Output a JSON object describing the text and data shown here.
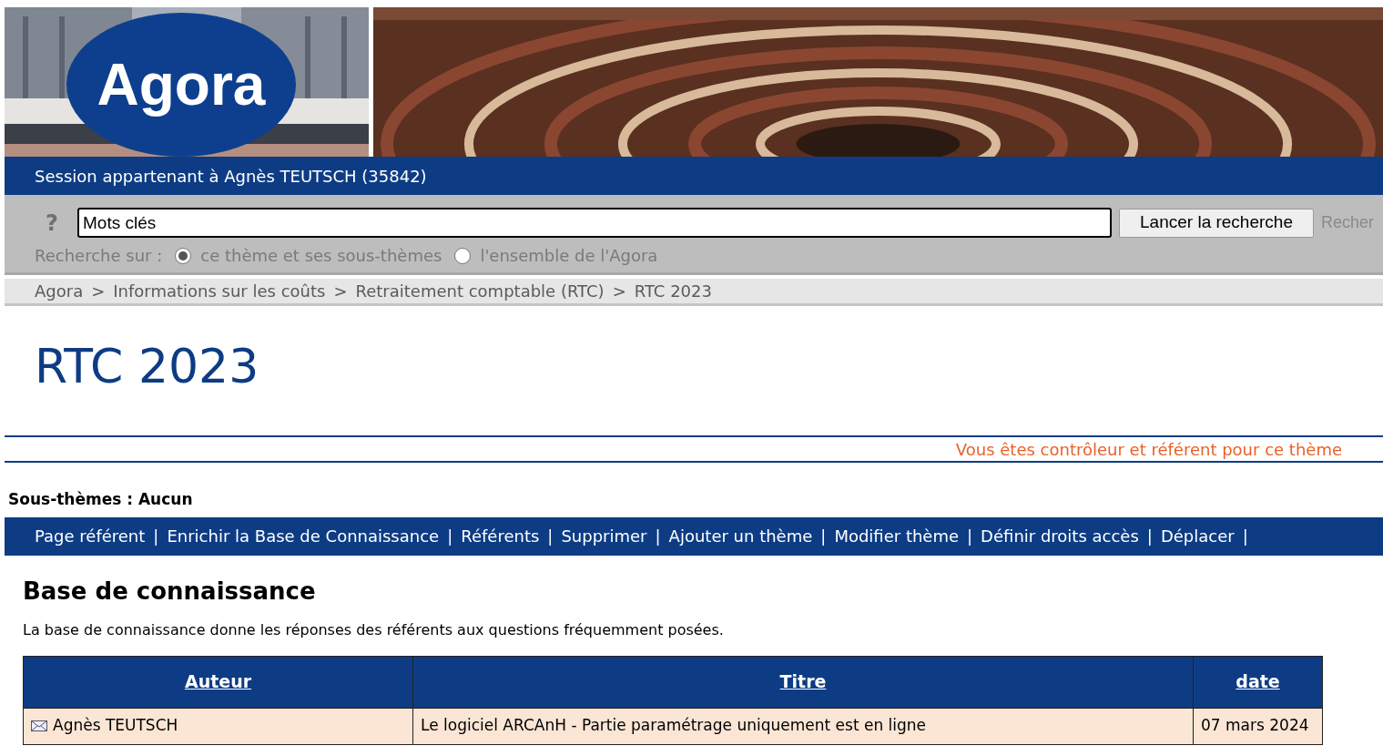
{
  "logo": {
    "text": "Agora"
  },
  "session_bar": {
    "text": "Session appartenant à Agnès TEUTSCH (35842)"
  },
  "search": {
    "help": "?",
    "value": "Mots clés",
    "button": "Lancer la recherche",
    "cut_link": "Recher",
    "scope_label": "Recherche sur :",
    "options": [
      {
        "label": "ce thème et ses sous-thèmes",
        "selected": true
      },
      {
        "label": "l'ensemble de l'Agora",
        "selected": false
      }
    ]
  },
  "breadcrumb": {
    "separator": ">",
    "items": [
      "Agora",
      "Informations sur les coûts",
      "Retraitement comptable (RTC)",
      "RTC 2023"
    ]
  },
  "page_title": "RTC 2023",
  "role_notice": "Vous êtes contrôleur et référent pour ce thème",
  "subthemes": "Sous-thèmes : Aucun",
  "actions": {
    "separator": "|",
    "items": [
      "Page référent",
      "Enrichir la Base de Connaissance",
      "Référents",
      "Supprimer",
      "Ajouter un thème",
      "Modifier thème",
      "Définir droits accès",
      "Déplacer"
    ]
  },
  "knowledge_base": {
    "title": "Base de connaissance",
    "description": "La base de connaissance donne les réponses des référents aux questions fréquemment posées.",
    "columns": [
      "Auteur",
      "Titre",
      "date"
    ],
    "rows": [
      {
        "author": "Agnès TEUTSCH",
        "title": "Le logiciel ARCAnH - Partie paramétrage uniquement est en ligne",
        "date": "07 mars 2024"
      }
    ]
  }
}
